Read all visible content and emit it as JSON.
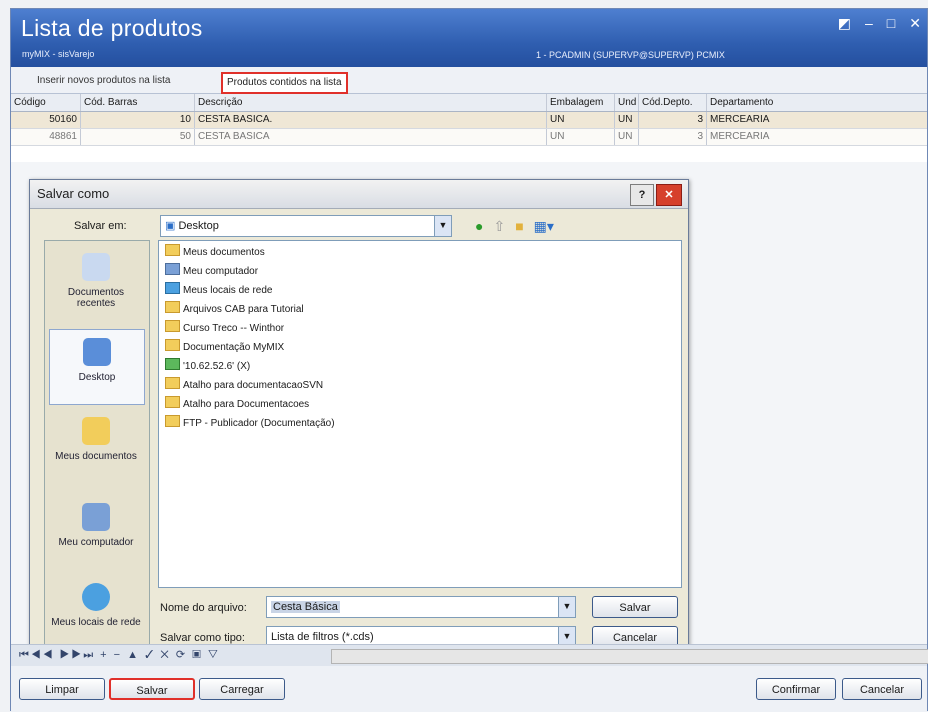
{
  "app": {
    "title": "Lista de produtos",
    "subtitle": "myMIX - sisVarejo",
    "connection": "1 - PCADMIN (SUPERVP@SUPERVP)  PCMIX"
  },
  "tabs": [
    {
      "label": "Inserir novos produtos na lista"
    },
    {
      "label": "Produtos contidos na lista",
      "selected": true
    }
  ],
  "grid": {
    "columns": [
      "Código",
      "Cód. Barras",
      "Descrição",
      "Embalagem",
      "Und",
      "Cód.Depto.",
      "Departamento"
    ],
    "rows": [
      [
        "50160",
        "10",
        "CESTA BASICA.",
        "UN",
        "UN",
        "3",
        "MERCEARIA"
      ],
      [
        "48861",
        "50",
        "CESTA BASICA",
        "UN",
        "UN",
        "3",
        "MERCEARIA"
      ]
    ]
  },
  "dialog": {
    "title": "Salvar como",
    "save_in_label": "Salvar em:",
    "save_in_value": "Desktop",
    "places": [
      "Documentos recentes",
      "Desktop",
      "Meus documentos",
      "Meu computador",
      "Meus locais de rede"
    ],
    "files": [
      "Meus documentos",
      "Meu computador",
      "Meus locais de rede",
      "Arquivos CAB para Tutorial",
      "Curso Treco -- Winthor",
      "Documentação MyMIX",
      "'10.62.52.6' (X)",
      "Atalho para documentacaoSVN",
      "Atalho para Documentacoes",
      "FTP - Publicador (Documentação)"
    ],
    "filename_label": "Nome do arquivo:",
    "filename_value": "Cesta Básica",
    "filetype_label": "Salvar como tipo:",
    "filetype_value": "Lista de filtros (*.cds)",
    "save_button": "Salvar",
    "cancel_button": "Cancelar"
  },
  "bottom": {
    "limpar": "Limpar",
    "salvar": "Salvar",
    "carregar": "Carregar",
    "confirmar": "Confirmar",
    "cancelar": "Cancelar"
  },
  "colors": {
    "title_blue": "#2f5eb0",
    "highlight_red": "#e0302a",
    "row_selected": "#efe7d6"
  }
}
